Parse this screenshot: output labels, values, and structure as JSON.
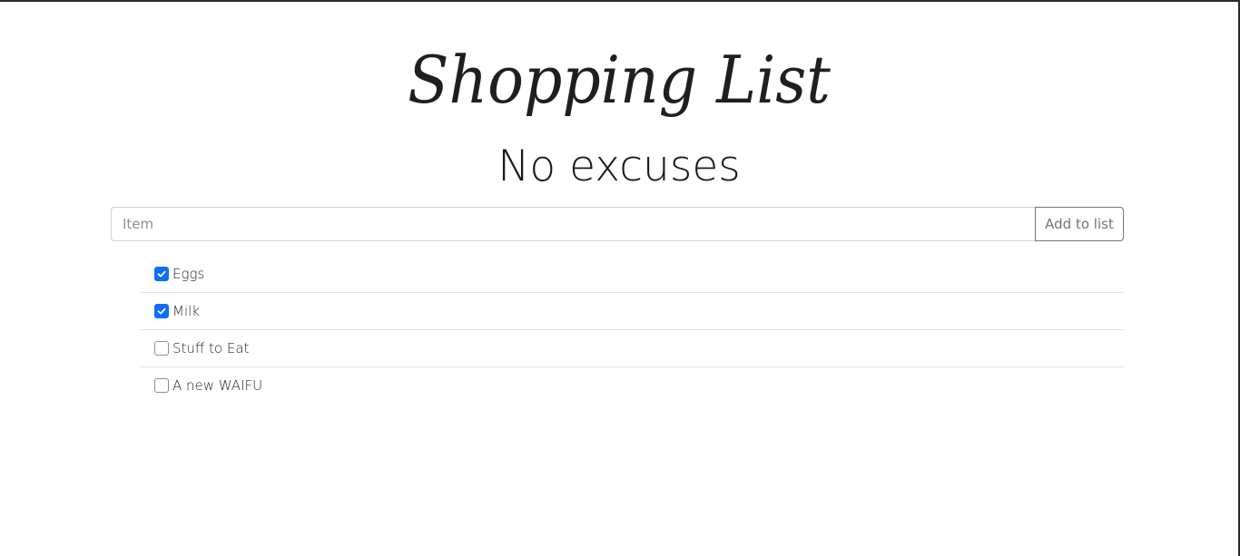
{
  "header": {
    "title": "Shopping List",
    "subtitle": "No excuses"
  },
  "form": {
    "input_placeholder": "Item",
    "input_value": "",
    "add_button_label": "Add to list"
  },
  "items": [
    {
      "label": "Eggs",
      "checked": true
    },
    {
      "label": "Milk",
      "checked": true
    },
    {
      "label": "Stuff to Eat",
      "checked": false
    },
    {
      "label": "A new WAIFU",
      "checked": false
    }
  ],
  "colors": {
    "checkbox_checked": "#0d6efd",
    "button_border": "#6c757d"
  }
}
